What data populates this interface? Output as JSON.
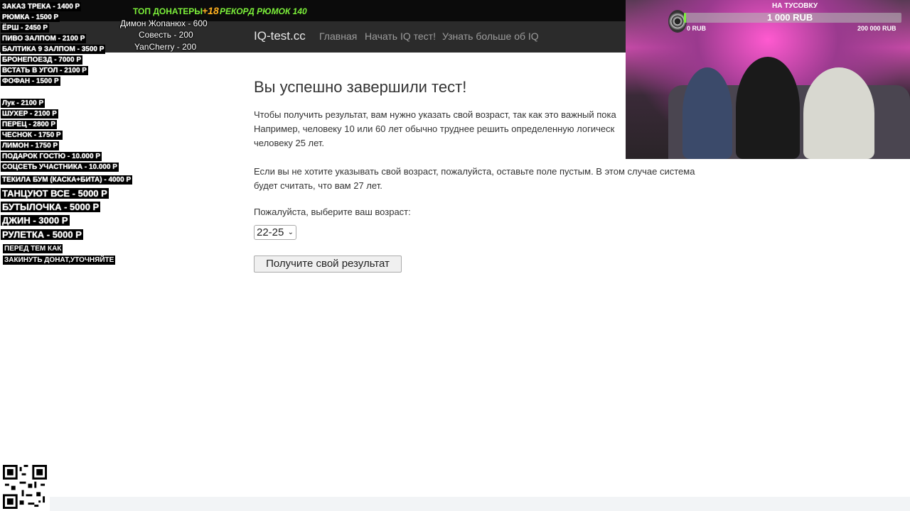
{
  "site": {
    "brand": "IQ-test.cc",
    "nav": [
      "Главная",
      "Начать IQ тест!",
      "Узнать больше об IQ"
    ]
  },
  "content": {
    "heading": "Вы успешно завершили тест!",
    "para1_lines": [
      "Чтобы получить результат, вам нужно указать свой возраст, так как это важный пока",
      "Например, человеку 10 или 60 лет обычно труднее решить определенную логическ",
      "человеку 25 лет."
    ],
    "para2_lines": [
      "Если вы не хотите указывать свой возраст, пожалуйста, оставьте поле пустым. В этом случае система",
      "будет считать, что вам 27 лет."
    ],
    "age_label": "Пожалуйста, выберите ваш возраст:",
    "age_value": "22-25",
    "submit_label": "Получите свой результат"
  },
  "overlay": {
    "top_donors_title": "ТОП ДОНАТЕРЫ",
    "plus18": "+18",
    "record": "РЕКОРД РЮМОК 140",
    "donors": [
      "Димон Жопанюх - 600",
      "Совесть - 200",
      "YanCherry - 200"
    ],
    "prices": [
      "ЗАКАЗ ТРЕКА - 1400 Р",
      "РЮМКА - 1500 Р",
      "ЁРШ - 2450 Р",
      "ПИВО ЗАЛПОМ - 2100 Р",
      "БАЛТИКА 9 ЗАЛПОМ - 3500 Р",
      "БРОНЕПОЕЗД - 7000 Р",
      "ВСТАТЬ В УГОЛ - 2100 Р",
      "ФОФАН - 1500 Р",
      "Лук - 2100 Р",
      "ШУХЕР - 2100 Р",
      "ПЕРЕЦ - 2800 Р",
      "ЧЕСНОК - 1750 Р",
      "ЛИМОН - 1750 Р",
      "ПОДАРОК ГОСТЮ - 10.000 Р",
      "СОЦСЕТЬ УЧАСТНИКА - 10.000 Р",
      "ТЕКИЛА БУМ (КАСКА+БИТА) - 4000 Р",
      "ТАНЦУЮТ ВСЕ - 5000 Р",
      "БУТЫЛОЧКА - 5000 Р",
      "ДЖИН - 3000 Р",
      "РУЛЕТКА - 5000 Р"
    ],
    "note_lines": [
      "ПЕРЕД ТЕМ КАК",
      "ЗАКИНУТЬ ДОНАТ,УТОЧНЯЙТЕ"
    ],
    "goal": {
      "title": "НА ТУСОВКУ",
      "current": "1 000 RUB",
      "min": "0 RUB",
      "max": "200 000 RUB",
      "fraction": 0.005
    }
  },
  "colors": {
    "navbar": "#2b2b2b",
    "accent_green": "#7cf03a",
    "webcam_pink": "#ff5ad0"
  }
}
